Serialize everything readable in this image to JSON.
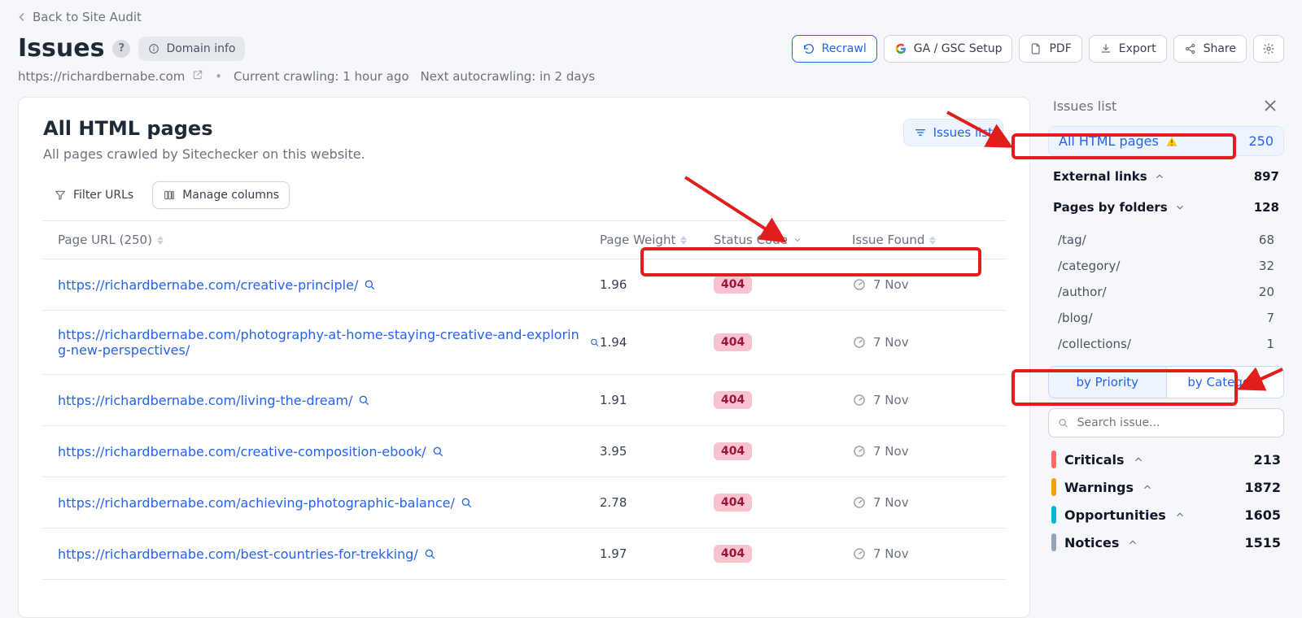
{
  "nav": {
    "back": "Back to Site Audit"
  },
  "page": {
    "title": "Issues",
    "domain_info": "Domain info",
    "domain": "https://richardbernabe.com",
    "crawl_status": "Current crawling: 1 hour ago",
    "next_crawl": "Next autocrawling: in 2 days"
  },
  "toolbar": {
    "recrawl": "Recrawl",
    "ga_gsc": "GA / GSC Setup",
    "pdf": "PDF",
    "export": "Export",
    "share": "Share"
  },
  "section": {
    "title": "All HTML pages",
    "subtitle": "All pages crawled by Sitechecker on this website.",
    "issues_list": "Issues list",
    "filter": "Filter URLs",
    "manage_cols": "Manage columns"
  },
  "columns": {
    "url": "Page URL (250)",
    "page_weight": "Page Weight",
    "status_code": "Status Code",
    "issue_found": "Issue Found"
  },
  "rows": [
    {
      "url": "https://richardbernabe.com/creative-principle/",
      "weight": "1.96",
      "status": "404",
      "found": "7 Nov"
    },
    {
      "url": "https://richardbernabe.com/photography-at-home-staying-creative-and-exploring-new-perspectives/",
      "weight": "1.94",
      "status": "404",
      "found": "7 Nov"
    },
    {
      "url": "https://richardbernabe.com/living-the-dream/",
      "weight": "1.91",
      "status": "404",
      "found": "7 Nov"
    },
    {
      "url": "https://richardbernabe.com/creative-composition-ebook/",
      "weight": "3.95",
      "status": "404",
      "found": "7 Nov"
    },
    {
      "url": "https://richardbernabe.com/achieving-photographic-balance/",
      "weight": "2.78",
      "status": "404",
      "found": "7 Nov"
    },
    {
      "url": "https://richardbernabe.com/best-countries-for-trekking/",
      "weight": "1.97",
      "status": "404",
      "found": "7 Nov"
    }
  ],
  "sidebar": {
    "header": "Issues list",
    "all_html": {
      "label": "All HTML pages",
      "count": "250"
    },
    "external": {
      "label": "External links",
      "count": "897"
    },
    "by_folders": {
      "label": "Pages by folders",
      "count": "128"
    },
    "folders": [
      {
        "name": "/tag/",
        "count": "68"
      },
      {
        "name": "/category/",
        "count": "32"
      },
      {
        "name": "/author/",
        "count": "20"
      },
      {
        "name": "/blog/",
        "count": "7"
      },
      {
        "name": "/collections/",
        "count": "1"
      }
    ],
    "tabs": {
      "priority": "by Priority",
      "category": "by Category"
    },
    "search_placeholder": "Search issue...",
    "severity": [
      {
        "name": "Criticals",
        "count": "213",
        "color": "#ff6b6b"
      },
      {
        "name": "Warnings",
        "count": "1872",
        "color": "#f59e0b"
      },
      {
        "name": "Opportunities",
        "count": "1605",
        "color": "#06b6d4"
      },
      {
        "name": "Notices",
        "count": "1515",
        "color": "#93a3b8"
      }
    ]
  }
}
